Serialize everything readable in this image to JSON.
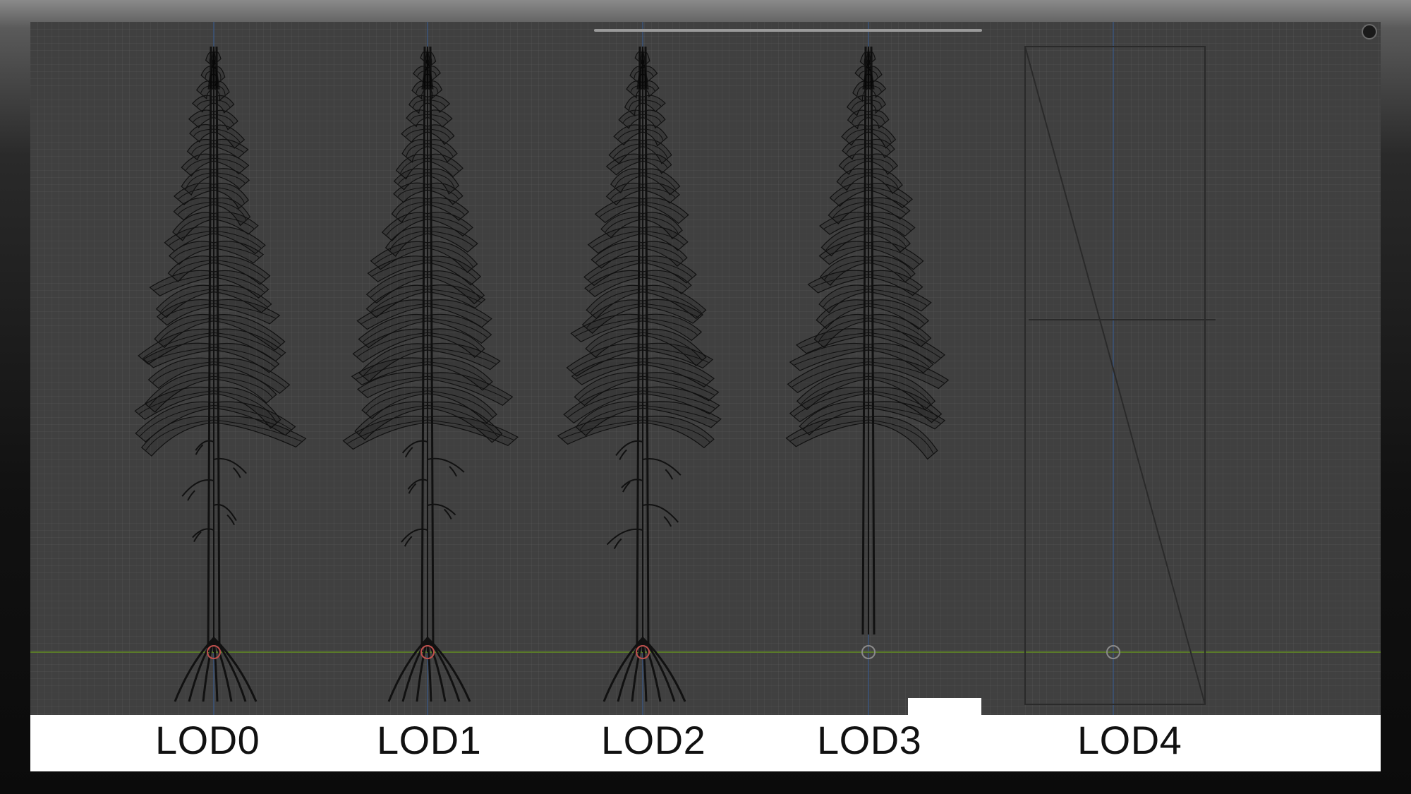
{
  "labels": {
    "lod0": "LOD0",
    "lod1": "LOD1",
    "lod2": "LOD2",
    "lod3": "LOD3",
    "lod4": "LOD4"
  },
  "colors": {
    "viewport_bg": "#404040",
    "ground_line": "#5a7a2a",
    "axis_line": "#3a5a8a",
    "wireframe": "#111111",
    "origin_marker": "#c0504d",
    "label_bg": "#ffffff",
    "label_text": "#111111"
  },
  "icons": {
    "origin": "origin-marker-icon",
    "corner": "viewport-corner-icon"
  }
}
